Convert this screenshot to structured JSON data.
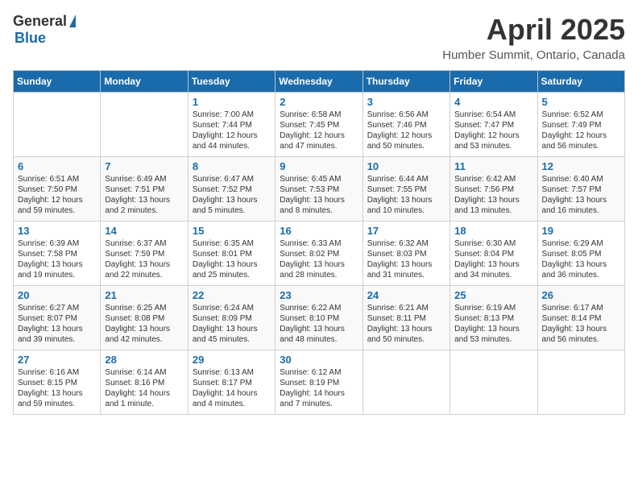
{
  "header": {
    "logo_general": "General",
    "logo_blue": "Blue",
    "title": "April 2025",
    "subtitle": "Humber Summit, Ontario, Canada"
  },
  "days_of_week": [
    "Sunday",
    "Monday",
    "Tuesday",
    "Wednesday",
    "Thursday",
    "Friday",
    "Saturday"
  ],
  "weeks": [
    [
      {
        "day": "",
        "content": ""
      },
      {
        "day": "",
        "content": ""
      },
      {
        "day": "1",
        "content": "Sunrise: 7:00 AM\nSunset: 7:44 PM\nDaylight: 12 hours and 44 minutes."
      },
      {
        "day": "2",
        "content": "Sunrise: 6:58 AM\nSunset: 7:45 PM\nDaylight: 12 hours and 47 minutes."
      },
      {
        "day": "3",
        "content": "Sunrise: 6:56 AM\nSunset: 7:46 PM\nDaylight: 12 hours and 50 minutes."
      },
      {
        "day": "4",
        "content": "Sunrise: 6:54 AM\nSunset: 7:47 PM\nDaylight: 12 hours and 53 minutes."
      },
      {
        "day": "5",
        "content": "Sunrise: 6:52 AM\nSunset: 7:49 PM\nDaylight: 12 hours and 56 minutes."
      }
    ],
    [
      {
        "day": "6",
        "content": "Sunrise: 6:51 AM\nSunset: 7:50 PM\nDaylight: 12 hours and 59 minutes."
      },
      {
        "day": "7",
        "content": "Sunrise: 6:49 AM\nSunset: 7:51 PM\nDaylight: 13 hours and 2 minutes."
      },
      {
        "day": "8",
        "content": "Sunrise: 6:47 AM\nSunset: 7:52 PM\nDaylight: 13 hours and 5 minutes."
      },
      {
        "day": "9",
        "content": "Sunrise: 6:45 AM\nSunset: 7:53 PM\nDaylight: 13 hours and 8 minutes."
      },
      {
        "day": "10",
        "content": "Sunrise: 6:44 AM\nSunset: 7:55 PM\nDaylight: 13 hours and 10 minutes."
      },
      {
        "day": "11",
        "content": "Sunrise: 6:42 AM\nSunset: 7:56 PM\nDaylight: 13 hours and 13 minutes."
      },
      {
        "day": "12",
        "content": "Sunrise: 6:40 AM\nSunset: 7:57 PM\nDaylight: 13 hours and 16 minutes."
      }
    ],
    [
      {
        "day": "13",
        "content": "Sunrise: 6:39 AM\nSunset: 7:58 PM\nDaylight: 13 hours and 19 minutes."
      },
      {
        "day": "14",
        "content": "Sunrise: 6:37 AM\nSunset: 7:59 PM\nDaylight: 13 hours and 22 minutes."
      },
      {
        "day": "15",
        "content": "Sunrise: 6:35 AM\nSunset: 8:01 PM\nDaylight: 13 hours and 25 minutes."
      },
      {
        "day": "16",
        "content": "Sunrise: 6:33 AM\nSunset: 8:02 PM\nDaylight: 13 hours and 28 minutes."
      },
      {
        "day": "17",
        "content": "Sunrise: 6:32 AM\nSunset: 8:03 PM\nDaylight: 13 hours and 31 minutes."
      },
      {
        "day": "18",
        "content": "Sunrise: 6:30 AM\nSunset: 8:04 PM\nDaylight: 13 hours and 34 minutes."
      },
      {
        "day": "19",
        "content": "Sunrise: 6:29 AM\nSunset: 8:05 PM\nDaylight: 13 hours and 36 minutes."
      }
    ],
    [
      {
        "day": "20",
        "content": "Sunrise: 6:27 AM\nSunset: 8:07 PM\nDaylight: 13 hours and 39 minutes."
      },
      {
        "day": "21",
        "content": "Sunrise: 6:25 AM\nSunset: 8:08 PM\nDaylight: 13 hours and 42 minutes."
      },
      {
        "day": "22",
        "content": "Sunrise: 6:24 AM\nSunset: 8:09 PM\nDaylight: 13 hours and 45 minutes."
      },
      {
        "day": "23",
        "content": "Sunrise: 6:22 AM\nSunset: 8:10 PM\nDaylight: 13 hours and 48 minutes."
      },
      {
        "day": "24",
        "content": "Sunrise: 6:21 AM\nSunset: 8:11 PM\nDaylight: 13 hours and 50 minutes."
      },
      {
        "day": "25",
        "content": "Sunrise: 6:19 AM\nSunset: 8:13 PM\nDaylight: 13 hours and 53 minutes."
      },
      {
        "day": "26",
        "content": "Sunrise: 6:17 AM\nSunset: 8:14 PM\nDaylight: 13 hours and 56 minutes."
      }
    ],
    [
      {
        "day": "27",
        "content": "Sunrise: 6:16 AM\nSunset: 8:15 PM\nDaylight: 13 hours and 59 minutes."
      },
      {
        "day": "28",
        "content": "Sunrise: 6:14 AM\nSunset: 8:16 PM\nDaylight: 14 hours and 1 minute."
      },
      {
        "day": "29",
        "content": "Sunrise: 6:13 AM\nSunset: 8:17 PM\nDaylight: 14 hours and 4 minutes."
      },
      {
        "day": "30",
        "content": "Sunrise: 6:12 AM\nSunset: 8:19 PM\nDaylight: 14 hours and 7 minutes."
      },
      {
        "day": "",
        "content": ""
      },
      {
        "day": "",
        "content": ""
      },
      {
        "day": "",
        "content": ""
      }
    ]
  ]
}
